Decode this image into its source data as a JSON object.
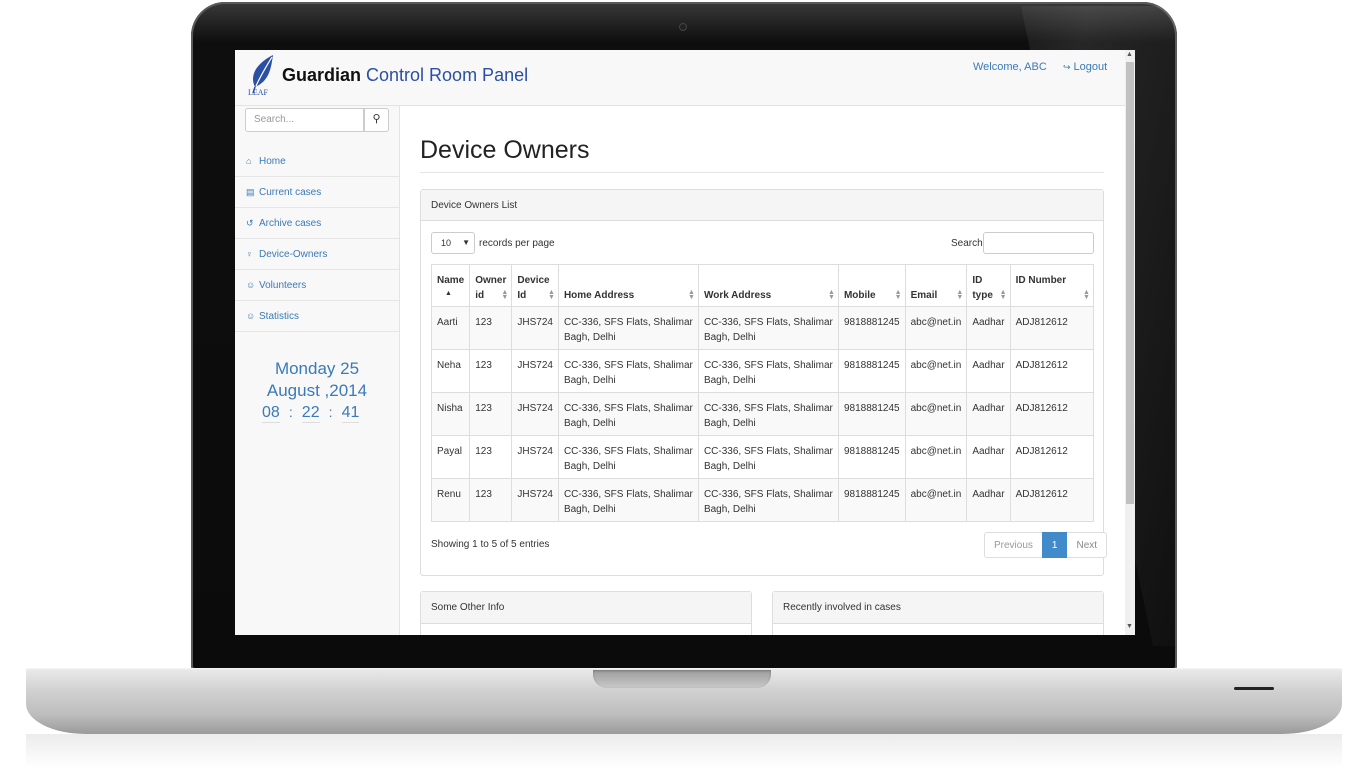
{
  "header": {
    "brand_bold": "Guardian",
    "brand_rest": " Control Room Panel",
    "logo_text": "LEAF",
    "welcome": "Welcome, ABC",
    "logout": "Logout"
  },
  "sidebar": {
    "search_placeholder": "Search...",
    "items": [
      {
        "label": "Home",
        "icon": "home-icon"
      },
      {
        "label": "Current cases",
        "icon": "book-icon"
      },
      {
        "label": "Archive cases",
        "icon": "history-icon"
      },
      {
        "label": "Device-Owners",
        "icon": "person-icon"
      },
      {
        "label": "Volunteers",
        "icon": "group-icon"
      },
      {
        "label": "Statistics",
        "icon": "group-icon"
      }
    ],
    "date_line1": "Monday 25",
    "date_line2": "August ,2014",
    "clock": {
      "h": "08",
      "m": "22",
      "s": "41",
      "sep": ":"
    }
  },
  "main": {
    "title": "Device Owners",
    "panel_title": "Device Owners List",
    "page_length": "10",
    "records_label": "records per page",
    "search_label": "Search:",
    "columns": [
      {
        "l1": "Name",
        "l2": ""
      },
      {
        "l1": "Owner",
        "l2": "id"
      },
      {
        "l1": "Device",
        "l2": "Id"
      },
      {
        "l1": "",
        "l2": "Home Address"
      },
      {
        "l1": "",
        "l2": "Work Address"
      },
      {
        "l1": "",
        "l2": "Mobile"
      },
      {
        "l1": "",
        "l2": "Email"
      },
      {
        "l1": "ID",
        "l2": "type"
      },
      {
        "l1": "ID Number",
        "l2": ""
      }
    ],
    "rows": [
      {
        "name": "Aarti",
        "owner_id": "123",
        "device_id": "JHS724",
        "home": "CC-336, SFS Flats, Shalimar Bagh, Delhi",
        "work": "CC-336, SFS Flats, Shalimar Bagh, Delhi",
        "mobile": "9818881245",
        "email": "abc@net.in",
        "id_type": "Aadhar",
        "id_number": "ADJ812612"
      },
      {
        "name": "Neha",
        "owner_id": "123",
        "device_id": "JHS724",
        "home": "CC-336, SFS Flats, Shalimar Bagh, Delhi",
        "work": "CC-336, SFS Flats, Shalimar Bagh, Delhi",
        "mobile": "9818881245",
        "email": "abc@net.in",
        "id_type": "Aadhar",
        "id_number": "ADJ812612"
      },
      {
        "name": "Nisha",
        "owner_id": "123",
        "device_id": "JHS724",
        "home": "CC-336, SFS Flats, Shalimar Bagh, Delhi",
        "work": "CC-336, SFS Flats, Shalimar Bagh, Delhi",
        "mobile": "9818881245",
        "email": "abc@net.in",
        "id_type": "Aadhar",
        "id_number": "ADJ812612"
      },
      {
        "name": "Payal",
        "owner_id": "123",
        "device_id": "JHS724",
        "home": "CC-336, SFS Flats, Shalimar Bagh, Delhi",
        "work": "CC-336, SFS Flats, Shalimar Bagh, Delhi",
        "mobile": "9818881245",
        "email": "abc@net.in",
        "id_type": "Aadhar",
        "id_number": "ADJ812612"
      },
      {
        "name": "Renu",
        "owner_id": "123",
        "device_id": "JHS724",
        "home": "CC-336, SFS Flats, Shalimar Bagh, Delhi",
        "work": "CC-336, SFS Flats, Shalimar Bagh, Delhi",
        "mobile": "9818881245",
        "email": "abc@net.in",
        "id_type": "Aadhar",
        "id_number": "ADJ812612"
      }
    ],
    "info": "Showing 1 to 5 of 5 entries",
    "pager": {
      "prev": "Previous",
      "current": "1",
      "next": "Next"
    },
    "panel2_title": "Some Other Info",
    "panel3_title": "Recently involved in cases"
  },
  "colors": {
    "accent": "#3a7ab8",
    "brand": "#2a4fa3",
    "pager_active": "#428bca"
  }
}
